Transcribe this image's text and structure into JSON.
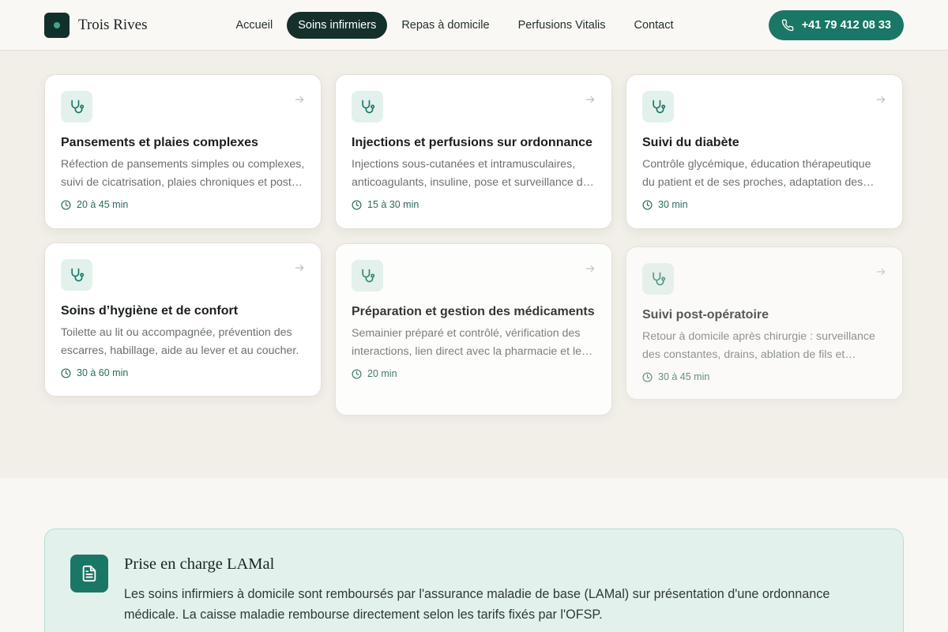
{
  "brand": {
    "name": "Trois Rives"
  },
  "nav": [
    {
      "label": "Accueil"
    },
    {
      "label": "Soins infirmiers"
    },
    {
      "label": "Repas à domicile"
    },
    {
      "label": "Perfusions Vitalis"
    },
    {
      "label": "Contact"
    }
  ],
  "phone": {
    "label": "+41 79 412 08 33"
  },
  "cards": [
    {
      "title": "Pansements et plaies complexes",
      "desc": "Réfection de pansements simples ou complexes, suivi de cicatrisation, plaies chroniques et post-opératoires.",
      "time": "20 à 45 min"
    },
    {
      "title": "Injections et perfusions sur ordonnance",
      "desc": "Injections sous-cutanées et intramusculaires, anticoagulants, insuline, pose et surveillance de perfusions.",
      "time": "15 à 30 min"
    },
    {
      "title": "Suivi du diabète",
      "desc": "Contrôle glycémique, éducation thérapeutique du patient et de ses proches, adaptation des traitements.",
      "time": "30 min"
    },
    {
      "title": "Soins d’hygiène et de confort",
      "desc": "Toilette au lit ou accompagnée, prévention des escarres, habillage, aide au lever et au coucher.",
      "time": "30 à 60 min"
    },
    {
      "title": "Préparation et gestion des médicaments",
      "desc": "Semainier préparé et contrôlé, vérification des interactions, lien direct avec la pharmacie et le médecin.",
      "time": "20 min"
    },
    {
      "title": "Suivi post-opératoire",
      "desc": "Retour à domicile après chirurgie : surveillance des constantes, drains, ablation de fils et agrafes.",
      "time": "30 à 45 min"
    }
  ],
  "info": {
    "title": "Prise en charge LAMal",
    "text": "Les soins infirmiers à domicile sont remboursés par l'assurance maladie de base (LAMal) sur présentation d'une ordonnance médicale. La caisse maladie rembourse directement selon les tarifs fixés par l'OFSP."
  },
  "icons": {
    "brand": "brand-logo-icon",
    "phone": "phone-icon",
    "card": "stethoscope-icon",
    "arrow": "arrow-right-icon",
    "time": "clock-icon",
    "info": "document-icon"
  },
  "colors": {
    "accent": "#1a7766",
    "dark": "#15302b",
    "icon_bg": "#e2f1ec",
    "page_bg": "#f1efe8"
  }
}
